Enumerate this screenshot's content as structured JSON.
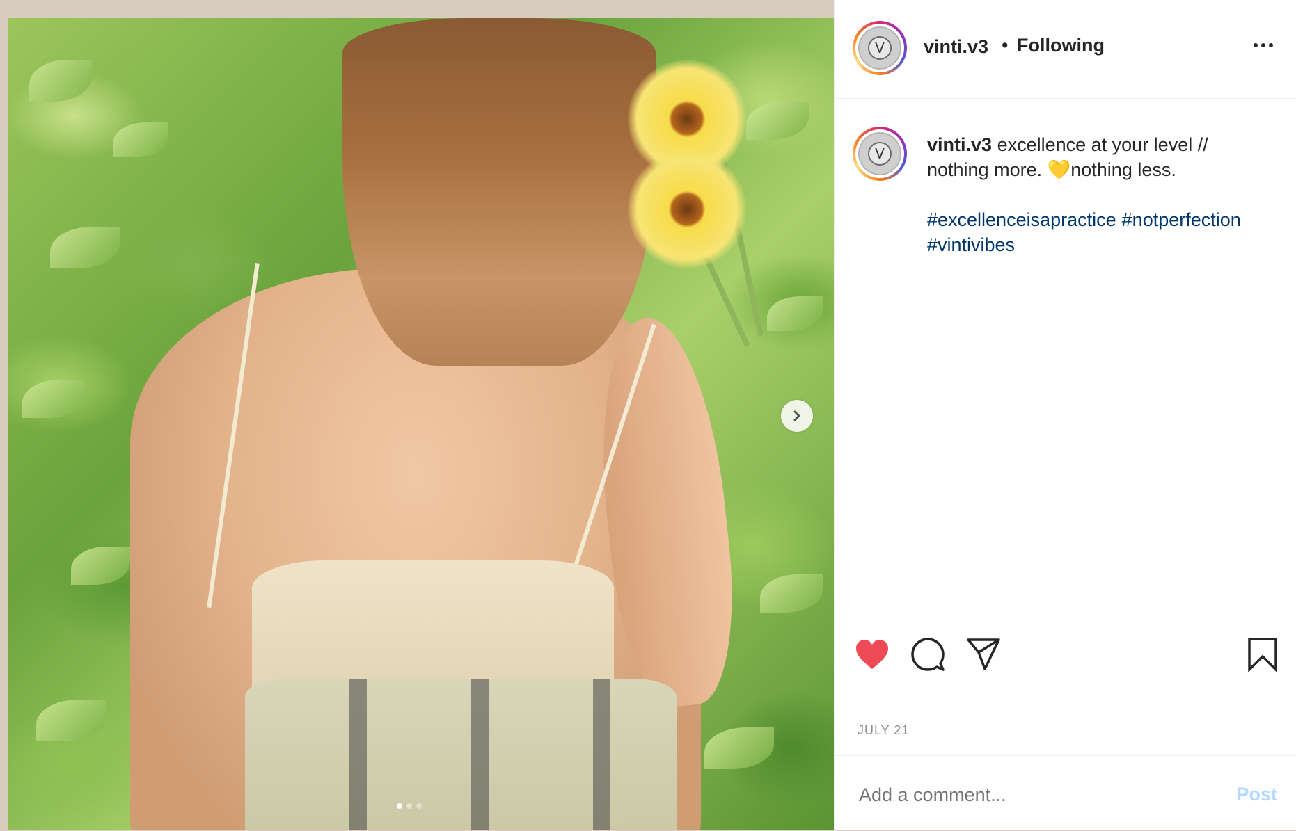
{
  "post": {
    "username": "vinti.v3",
    "separator": "•",
    "follow_status": "Following",
    "caption_username": "vinti.v3",
    "caption_line1": "excellence at your level //",
    "caption_line2_pre": "nothing more.",
    "caption_emoji": "💛",
    "caption_line2_post": "nothing less.",
    "hashtags": [
      "#excellenceisapractice",
      "#notperfection",
      "#vintivibes"
    ],
    "date": "JULY 21",
    "liked": true
  },
  "avatar": {
    "letter": "V"
  },
  "carousel": {
    "total": 3,
    "active": 0
  },
  "comment": {
    "placeholder": "Add a comment...",
    "post_label": "Post"
  },
  "icons": {
    "like": "heart-icon",
    "comment": "comment-icon",
    "share": "share-icon",
    "save": "bookmark-icon",
    "more": "more-options-icon",
    "next": "chevron-right-icon"
  },
  "colors": {
    "like": "#ed4956",
    "hashtag": "#00376b",
    "post_disabled": "#b3dbff",
    "muted": "#8e8e8e"
  }
}
